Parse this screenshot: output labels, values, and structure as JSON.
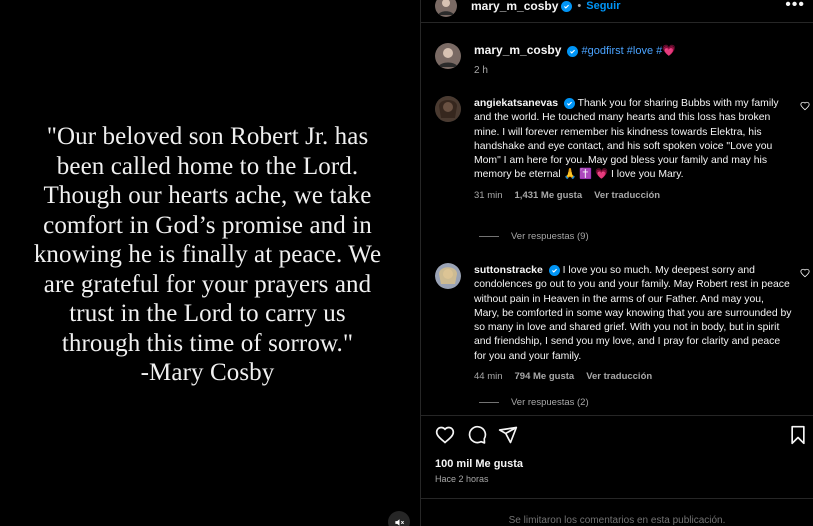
{
  "media": {
    "quote": "\"Our beloved son Robert Jr. has\nbeen called home to the Lord.\nThough our hearts ache, we take\ncomfort in God’s promise and in\nknowing he is finally at peace. We\nare grateful for your prayers and\ntrust in the Lord to carry us\nthrough this time of sorrow.\"\n-Mary Cosby",
    "mute_icon": "speaker-muted-icon"
  },
  "header": {
    "username": "mary_m_cosby",
    "separator": "•",
    "follow_label": "Seguir",
    "more_icon": "more-options-icon"
  },
  "caption": {
    "username": "mary_m_cosby",
    "text": "#godfirst #love #",
    "emoji": "💗",
    "time": "2 h"
  },
  "comments": [
    {
      "username": "angiekatsanevas",
      "text": "Thank you for sharing Bubbs with my family and the world. He touched many hearts and this loss has broken mine. I will forever remember his kindness towards Elektra, his handshake and eye contact, and his soft spoken voice \"Love you Mom\" I am here for you..May god bless your family and may his memory be eternal 🙏 ✝️ 💗 I love you Mary.",
      "time": "31 min",
      "likes": "1,431 Me gusta",
      "translate": "Ver traducción",
      "replies": "Ver respuestas (9)"
    },
    {
      "username": "suttonstracke",
      "text": "I love you so much. My deepest sorry and condolences go out to you and your family. May Robert rest in peace without pain in Heaven in the arms of our Father. And may you, Mary, be comforted in some way knowing that you are surrounded by so many in love and shared grief. With you not in body, but in spirit and friendship, I send you my love, and I pray for clarity and peace for you and your family.",
      "time": "44 min",
      "likes": "794 Me gusta",
      "translate": "Ver traducción",
      "replies": "Ver respuestas (2)"
    }
  ],
  "actions": {
    "like_icon": "heart-icon",
    "comment_icon": "comment-icon",
    "share_icon": "share-icon",
    "save_icon": "bookmark-icon"
  },
  "likes_count": "100 mil Me gusta",
  "posted_ago": "Hace 2 horas",
  "comments_limited": "Se limitaron los comentarios en esta publicación."
}
